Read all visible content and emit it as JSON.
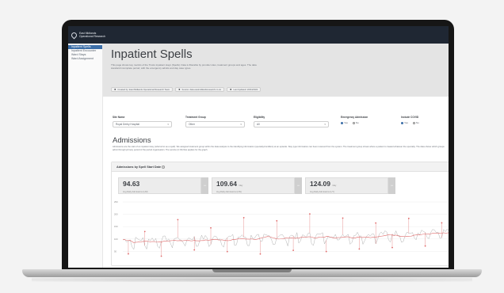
{
  "app": {
    "brand_line1": "East Midlands",
    "brand_line2": "Operational Research"
  },
  "sidebar": {
    "items": [
      {
        "label": "Inpatient Spells",
        "active": true
      },
      {
        "label": "Inpatient Encounter",
        "active": false
      },
      {
        "label": "Ward Stays",
        "active": false
      },
      {
        "label": "Ward Assignment",
        "active": false
      }
    ]
  },
  "hero": {
    "title": "Inpatient Spells",
    "description": "This page shows key metrics of the Trusts inpatient stays (Spells). Data is filterable by provider sites, treatment groups and ages. The data standard incomplete period, with the emergency admits and day case types.",
    "chips": [
      {
        "icon": "owner-icon",
        "label": "Created by: East Midlands Operational Research Team"
      },
      {
        "icon": "source-icon",
        "label": "Source: data.eastmidlandsresearch.co.uk"
      },
      {
        "icon": "refresh-icon",
        "label": "Last Updated: 20/04/2024"
      }
    ]
  },
  "filters": {
    "site": {
      "label": "Site Name",
      "value": "Royal Derby Hospital"
    },
    "treatment": {
      "label": "Treatment Group",
      "value": "Other"
    },
    "eligibility": {
      "label": "Eligibility",
      "value": "All"
    },
    "admission": {
      "label": "Emergency Admission",
      "options": [
        "Yes",
        "No"
      ],
      "selected": "Yes"
    },
    "include": {
      "label": "Include COVID",
      "options": [
        "Yes",
        "No"
      ],
      "selected": "Yes"
    }
  },
  "admissions": {
    "title": "Admissions",
    "description": "Admissions are the start of an inpatient stay (referred to as a spell). We assigned treatment group within the data analysis to the identifying information (specialty/condition) at an episode. Stay type information can been received from the system. The treatment group shows where a patient is treated whatever the specialty. The data shows which groups admit through primary period of the period organisation. The service (C:ID) files applies for the graph."
  },
  "chart_card": {
    "title": "Admissions by Spell Start Date",
    "info": "i",
    "kpis": [
      {
        "value": "94.63",
        "unit": "",
        "label": "Avg Daily Admissions (L/M)"
      },
      {
        "value": "109.64",
        "unit": "/day",
        "label": "Avg Daily Admissions (L/W)"
      },
      {
        "value": "124.09",
        "unit": "/day",
        "label": "Avg Daily Admissions (L/Y)"
      }
    ],
    "kpi_button_icon": "−"
  },
  "chart_data": {
    "type": "line",
    "title": "",
    "xlabel": "",
    "ylabel": "",
    "ylim": [
      0,
      250
    ],
    "y_ticks": [
      "250",
      "200",
      "150",
      "100",
      "50"
    ],
    "grid": true,
    "legend": "none",
    "series": [
      {
        "color": "#a9a9a9",
        "style": "daily values",
        "values_description_points": 180
      },
      {
        "color": "#e06a6a",
        "style": "rolling mean"
      }
    ],
    "colors": {
      "daily": "#a9a9a9",
      "trend": "#e06a6a",
      "outlier": "#e06a6a"
    }
  }
}
